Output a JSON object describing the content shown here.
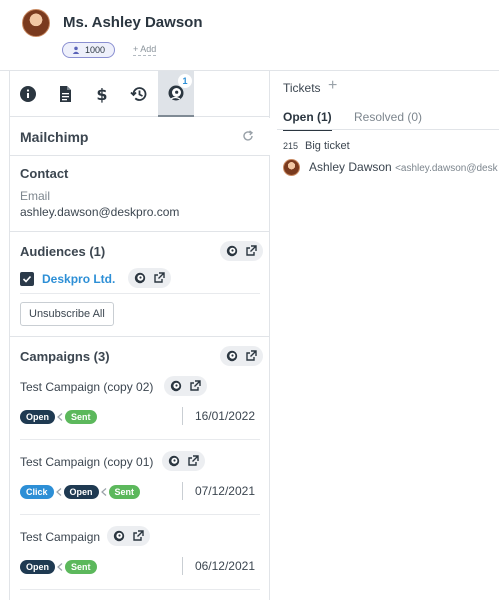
{
  "contact": {
    "name": "Ms. Ashley Dawson",
    "points": "1000",
    "add_label": "+ Add"
  },
  "tabs": [
    {
      "icon": "info-icon"
    },
    {
      "icon": "document-icon"
    },
    {
      "icon": "dollar-icon"
    },
    {
      "icon": "history-icon"
    },
    {
      "icon": "mailchimp-icon",
      "badge": "1"
    }
  ],
  "app": {
    "title": "Mailchimp",
    "contact": {
      "title": "Contact",
      "email_label": "Email",
      "email_value": "ashley.dawson@deskpro.com"
    },
    "audiences": {
      "title": "Audiences (1)",
      "items": [
        {
          "name": "Deskpro Ltd.",
          "checked": true
        }
      ],
      "unsubscribe_label": "Unsubscribe All"
    },
    "campaigns": {
      "title": "Campaigns (3)",
      "items": [
        {
          "name": "Test Campaign (copy 02)",
          "statuses": [
            "Open",
            "Sent"
          ],
          "date": "16/01/2022"
        },
        {
          "name": "Test Campaign (copy 01)",
          "statuses": [
            "Click",
            "Open",
            "Sent"
          ],
          "date": "07/12/2021"
        },
        {
          "name": "Test Campaign",
          "statuses": [
            "Open",
            "Sent"
          ],
          "date": "06/12/2021"
        }
      ]
    }
  },
  "tickets": {
    "title": "Tickets",
    "plus": "+",
    "tabs": [
      {
        "label": "Open (1)",
        "active": true
      },
      {
        "label": "Resolved (0)",
        "active": false
      }
    ],
    "items": [
      {
        "id": "215",
        "subject": "Big ticket",
        "person": "Ashley Dawson",
        "email": "<ashley.dawson@desk"
      }
    ]
  },
  "colors": {
    "accent": "#2d8fd6",
    "open": "#1f3a52",
    "sent": "#5cb85c",
    "click": "#2d8fd6"
  }
}
